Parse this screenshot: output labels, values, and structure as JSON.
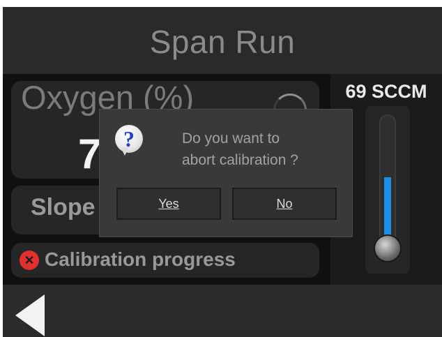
{
  "header": {
    "title": "Span Run"
  },
  "oxygen": {
    "label": "Oxygen (%)",
    "value": "7"
  },
  "slope": {
    "label": "Slope"
  },
  "calibration": {
    "progress_label": "Calibration progress",
    "status_icon": "error-icon"
  },
  "flow": {
    "label": "69 SCCM",
    "level_percent": 58
  },
  "dialog": {
    "message_line1": "Do you want to",
    "message_line2": "abort calibration ?",
    "yes_label": "Yes",
    "no_label": "No",
    "icon": "question-icon"
  },
  "nav": {
    "back_icon": "back-arrow-icon"
  },
  "colors": {
    "accent": "#1b8ee6",
    "error": "#e03030",
    "question": "#2440c8"
  }
}
